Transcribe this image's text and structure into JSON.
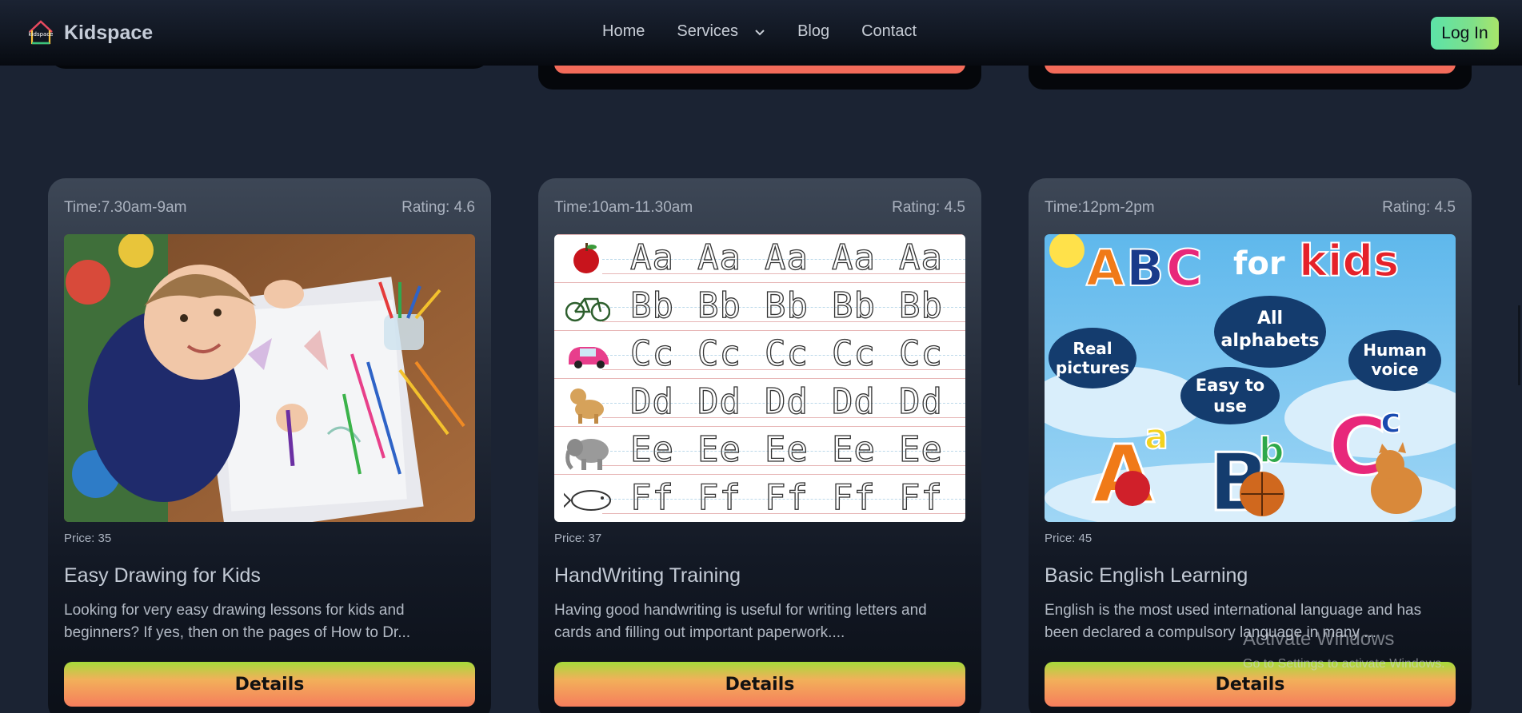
{
  "nav": {
    "brand": "Kidspace",
    "logo_text": "kidspace",
    "links": [
      {
        "label": "Home"
      },
      {
        "label": "Services"
      },
      {
        "label": "Blog"
      },
      {
        "label": "Contact"
      }
    ],
    "login_label": "Log In"
  },
  "cards": [
    {
      "time": "Time:7.30am-9am",
      "rating": "Rating: 4.6",
      "price": "Price: 35",
      "title": "Easy Drawing for Kids",
      "description": "Looking for very easy drawing lessons for kids and beginners? If yes, then on the pages of How to Dr...",
      "button": "Details"
    },
    {
      "time": "Time:10am-11.30am",
      "rating": "Rating: 4.5",
      "price": "Price: 37",
      "title": "HandWriting Training",
      "description": "Having good handwriting is useful for writing letters and cards and filling out important paperwork....",
      "button": "Details"
    },
    {
      "time": "Time:12pm-2pm",
      "rating": "Rating: 4.5",
      "price": "Price: 45",
      "title": "Basic English Learning",
      "description": "English is the most used international language and has been declared a compulsory language in many ...",
      "button": "Details"
    }
  ],
  "abc_image": {
    "headline_a": "A",
    "headline_b": "B",
    "headline_c": "C",
    "for_text": "for",
    "kids_text": "kids",
    "bubbles": [
      "Real pictures",
      "All alphabets",
      "Human voice",
      "Easy to use"
    ]
  },
  "tracing": {
    "rows": [
      "Aa",
      "Bb",
      "Cc",
      "Dd",
      "Ee",
      "Ff"
    ]
  },
  "watermark": {
    "title": "Activate Windows",
    "subtitle": "Go to Settings to activate Windows."
  },
  "colors": {
    "background": "#1b2333",
    "accent_orange": "#f67d5c",
    "accent_green": "#a6db3a",
    "login_green": "#7ee08a"
  }
}
